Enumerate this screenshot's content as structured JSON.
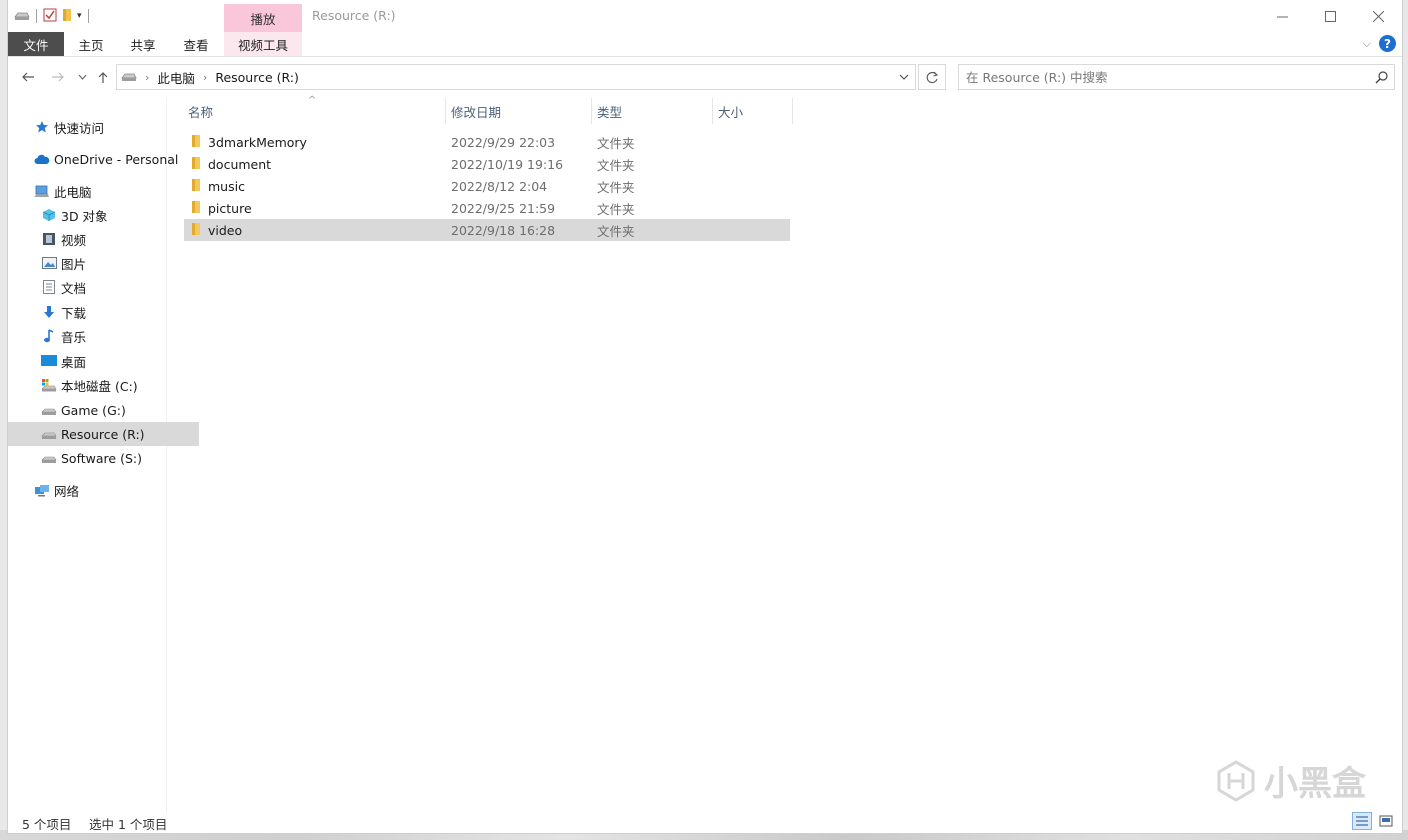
{
  "titlebar": {
    "title": "Resource (R:)",
    "context_tab_group": "播放"
  },
  "ribbon": {
    "tabs": [
      {
        "label": "文件",
        "type": "file"
      },
      {
        "label": "主页",
        "type": "normal"
      },
      {
        "label": "共享",
        "type": "normal"
      },
      {
        "label": "查看",
        "type": "normal"
      },
      {
        "label": "视频工具",
        "type": "contextual"
      }
    ],
    "help_label": "?"
  },
  "address": {
    "crumbs": [
      "此电脑",
      "Resource (R:)"
    ]
  },
  "search": {
    "placeholder": "在 Resource (R:) 中搜索"
  },
  "sidebar": {
    "items": [
      {
        "label": "快速访问",
        "icon": "star-icon"
      },
      {
        "label": "OneDrive - Personal",
        "icon": "cloud-icon"
      },
      {
        "label": "此电脑",
        "icon": "computer-icon"
      },
      {
        "label": "3D 对象",
        "icon": "cube-icon"
      },
      {
        "label": "视频",
        "icon": "film-icon"
      },
      {
        "label": "图片",
        "icon": "picture-icon"
      },
      {
        "label": "文档",
        "icon": "document-icon"
      },
      {
        "label": "下载",
        "icon": "download-icon"
      },
      {
        "label": "音乐",
        "icon": "music-icon"
      },
      {
        "label": "桌面",
        "icon": "desktop-icon"
      },
      {
        "label": "本地磁盘 (C:)",
        "icon": "system-drive-icon"
      },
      {
        "label": "Game (G:)",
        "icon": "drive-icon"
      },
      {
        "label": "Resource (R:)",
        "icon": "drive-icon",
        "selected": true
      },
      {
        "label": "Software (S:)",
        "icon": "drive-icon"
      },
      {
        "label": "网络",
        "icon": "network-icon"
      }
    ]
  },
  "columns": {
    "name": "名称",
    "date": "修改日期",
    "type": "类型",
    "size": "大小"
  },
  "files": [
    {
      "name": "3dmarkMemory",
      "date": "2022/9/29 22:03",
      "type": "文件夹"
    },
    {
      "name": "document",
      "date": "2022/10/19 19:16",
      "type": "文件夹"
    },
    {
      "name": "music",
      "date": "2022/8/12 2:04",
      "type": "文件夹"
    },
    {
      "name": "picture",
      "date": "2022/9/25 21:59",
      "type": "文件夹"
    },
    {
      "name": "video",
      "date": "2022/9/18 16:28",
      "type": "文件夹",
      "selected": true
    }
  ],
  "status": {
    "item_count": "5 个项目",
    "selection": "选中 1 个项目"
  },
  "watermark": "小黑盒",
  "colors": {
    "context_tab": "#f9c7d9",
    "file_tab": "#4d4d4d",
    "selection": "#d9d9d9",
    "accent": "#1f6fd1"
  }
}
